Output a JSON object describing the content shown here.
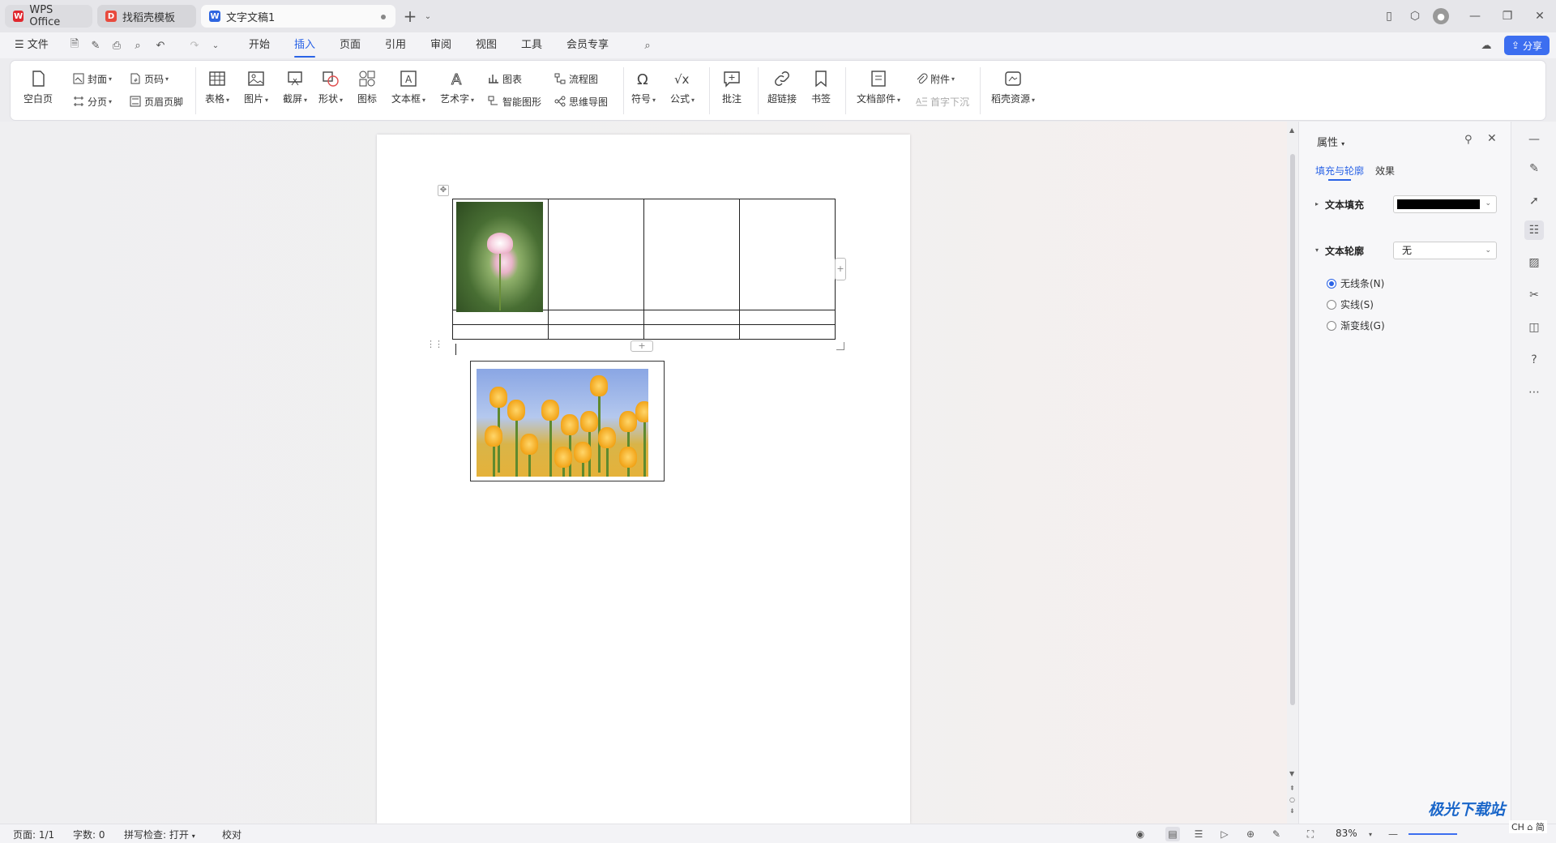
{
  "tabs": [
    {
      "label": "WPS Office"
    },
    {
      "label": "找稻壳模板"
    },
    {
      "label": "文字文稿1"
    }
  ],
  "menu": {
    "file": "文件",
    "items": [
      "开始",
      "插入",
      "页面",
      "引用",
      "审阅",
      "视图",
      "工具",
      "会员专享"
    ],
    "active": "插入",
    "share": "分享"
  },
  "ribbon": {
    "blank": "空白页",
    "cover": "封面",
    "pagebreak": "分页",
    "pagenum": "页码",
    "headerfooter": "页眉页脚",
    "table": "表格",
    "picture": "图片",
    "screenshot": "截屏",
    "shape": "形状",
    "icon": "图标",
    "textbox": "文本框",
    "wordart": "艺术字",
    "chart": "图表",
    "smartart": "智能图形",
    "flowchart": "流程图",
    "mindmap": "思维导图",
    "symbol": "符号",
    "formula": "公式",
    "comment": "批注",
    "hyperlink": "超链接",
    "bookmark": "书签",
    "docpart": "文档部件",
    "attachment": "附件",
    "dropcap": "首字下沉",
    "resources": "稻壳资源"
  },
  "panel": {
    "title": "属性",
    "tab_fill": "填充与轮廓",
    "tab_effect": "效果",
    "text_fill": "文本填充",
    "text_outline": "文本轮廓",
    "outline_value": "无",
    "radios": [
      {
        "label": "无线条(N)",
        "checked": true
      },
      {
        "label": "实线(S)",
        "checked": false
      },
      {
        "label": "渐变线(G)",
        "checked": false
      }
    ],
    "fill_color": "#000000"
  },
  "status": {
    "page": "页面: 1/1",
    "words": "字数: 0",
    "spell": "拼写检查: 打开",
    "proof": "校对",
    "zoom": "83%"
  },
  "watermark": {
    "text": "极光下载站",
    "sub": "CH ⌂ 简"
  }
}
